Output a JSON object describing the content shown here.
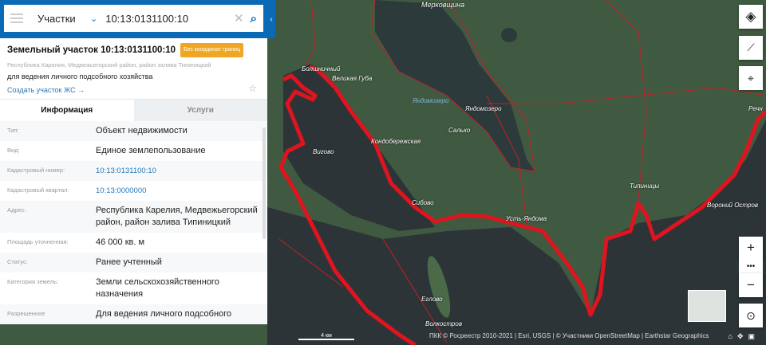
{
  "search": {
    "category": "Участки",
    "query": "10:13:0131100:10"
  },
  "header": {
    "title": "Земельный участок 10:13:0131100:10",
    "badge": "Без координат границ",
    "address": "Республика Карелия, Медвежьегорский район, район залива Типиницкий",
    "purpose": "для ведения личного подсобного хозяйства",
    "create_link": "Создать участок ЖС →"
  },
  "tabs": [
    {
      "label": "Информация"
    },
    {
      "label": "Услуги"
    }
  ],
  "info": [
    {
      "key": "Тип:",
      "value": "Объект недвижимости"
    },
    {
      "key": "Вид:",
      "value": "Единое землепользование"
    },
    {
      "key": "Кадастровый номер:",
      "value": "10:13:0131100:10"
    },
    {
      "key": "Кадастровый квартал:",
      "value": "10:13:0000000"
    },
    {
      "key": "Адрес:",
      "value": "Республика Карелия, Медвежьегорский район, район залива Типиницкий"
    },
    {
      "key": "Площадь уточненная:",
      "value": "46 000 кв. м"
    },
    {
      "key": "Статус:",
      "value": "Ранее учтенный"
    },
    {
      "key": "Категория земель:",
      "value": "Земли сельскохозяйственного назначения"
    },
    {
      "key": "Разрешенное",
      "value": "Для ведения личного подсобного"
    }
  ],
  "map": {
    "labels": [
      "Мерковщина",
      "Болшничный",
      "Великая Губа",
      "Яндомозеро",
      "Яндомозеро",
      "Салько",
      "Кондобережская",
      "Вигово",
      "Сибово",
      "Усть-Яндома",
      "Типиницы",
      "Вороний Остров",
      "Еглово",
      "Волкостров",
      "Речн"
    ],
    "scale": "4 км",
    "attribution": "ПКК © Росреестр 2010-2021 | Esri, USGS | © Участники OpenStreetMap | Earthstar Geographics"
  },
  "colors": {
    "accent": "#0a6ab5",
    "badge": "#f1a623",
    "boundary": "#e0141e"
  }
}
